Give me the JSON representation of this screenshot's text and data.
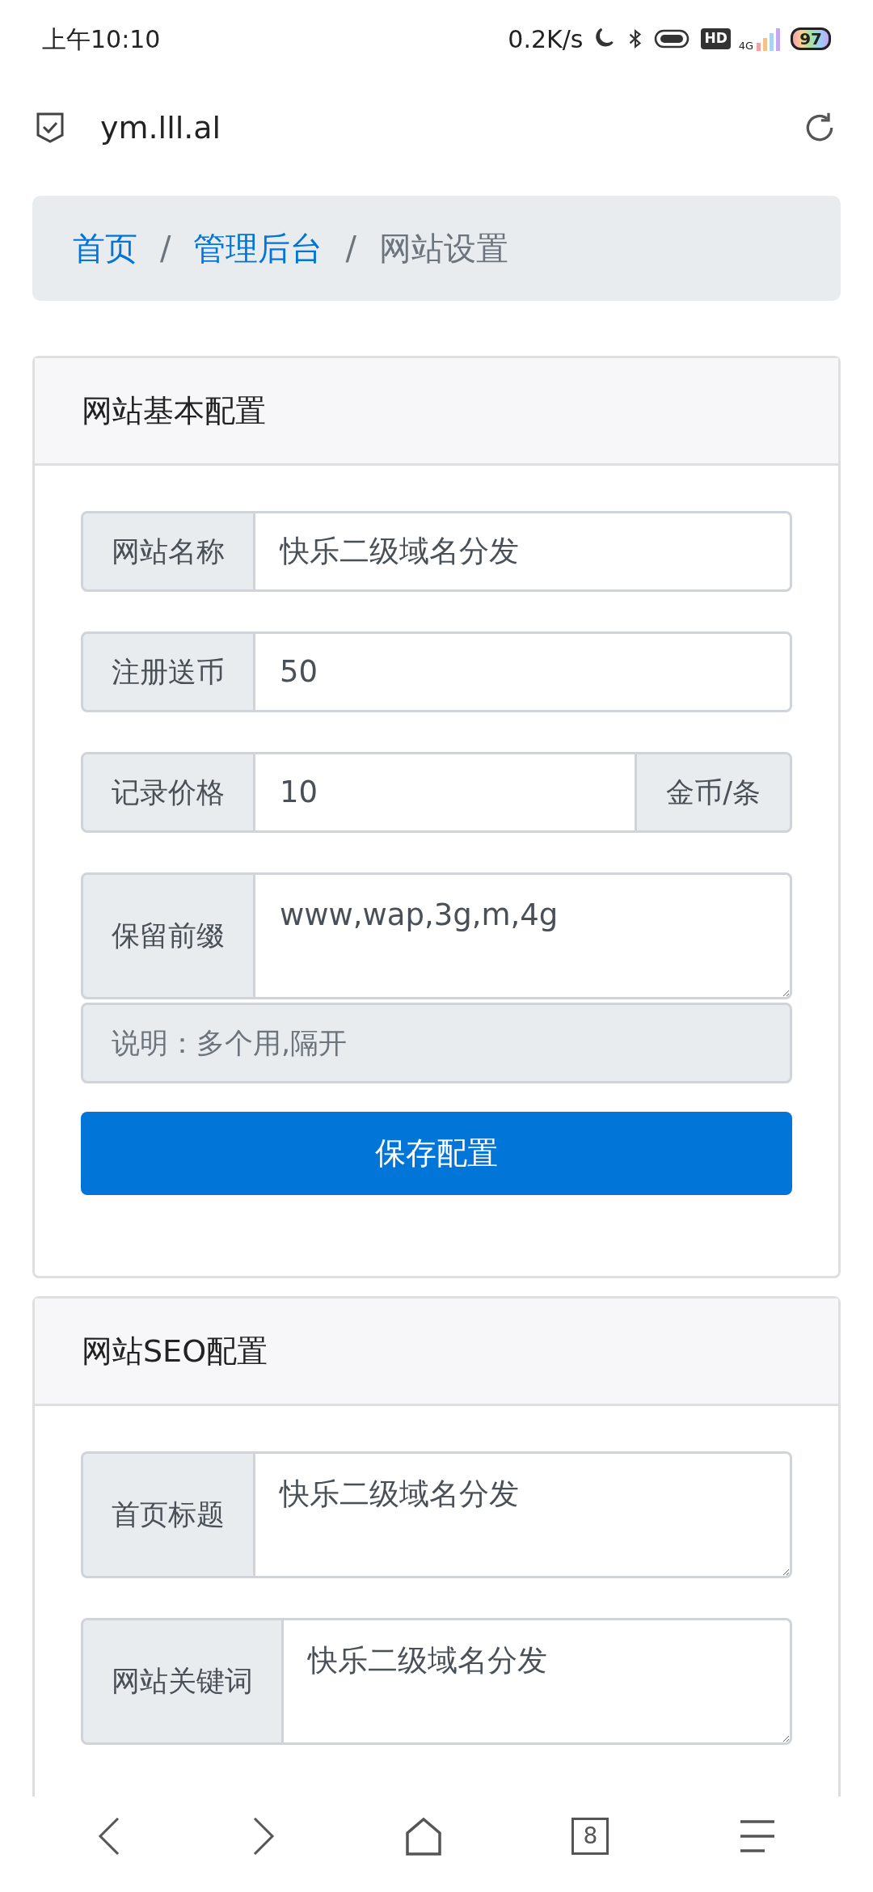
{
  "status_bar": {
    "time": "上午10:10",
    "speed": "0.2K/s",
    "hd": "HD",
    "network": "4G",
    "battery": "97"
  },
  "address_bar": {
    "url": "ym.lll.al"
  },
  "breadcrumb_separator": "/",
  "breadcrumb": [
    {
      "label": "首页",
      "kind": "link"
    },
    {
      "label": "管理后台",
      "kind": "link"
    },
    {
      "label": "网站设置",
      "kind": "current"
    }
  ],
  "cards": [
    {
      "title": "网站基本配置",
      "fields": [
        {
          "kind": "input",
          "label": "网站名称",
          "value": "快乐二级域名分发"
        },
        {
          "kind": "input",
          "label": "注册送币",
          "value": "50"
        },
        {
          "kind": "input",
          "label": "记录价格",
          "value": "10",
          "suffix": "金币/条"
        },
        {
          "kind": "textarea",
          "label": "保留前缀",
          "value": "www,wap,3g,m,4g",
          "help": "说明：多个用,隔开"
        }
      ],
      "button": "保存配置"
    },
    {
      "title": "网站SEO配置",
      "fields": [
        {
          "kind": "textarea",
          "label": "首页标题",
          "value": "快乐二级域名分发"
        },
        {
          "kind": "textarea",
          "label": "网站关键词",
          "value": "快乐二级域名分发"
        }
      ]
    }
  ],
  "bottom_nav": {
    "tab_count": "8"
  }
}
